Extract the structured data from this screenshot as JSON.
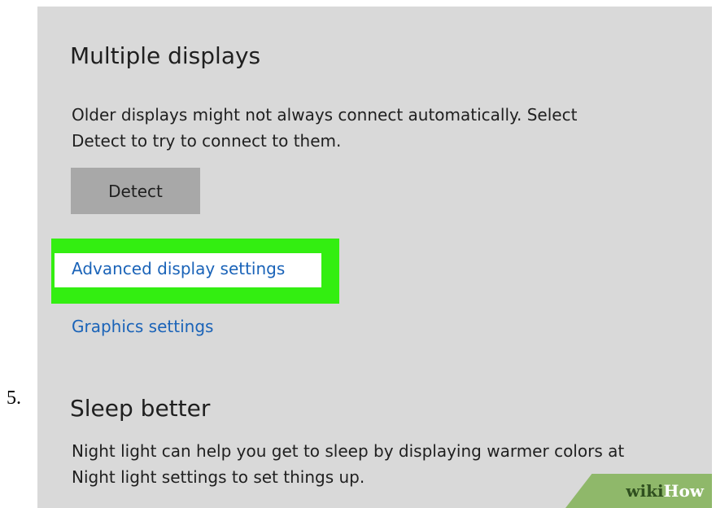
{
  "step": {
    "number": "5."
  },
  "multiple_displays": {
    "title": "Multiple displays",
    "description_line1": "Older displays might not always connect automatically. Select",
    "description_line2": "Detect to try to connect to them.",
    "detect_label": "Detect",
    "advanced_link": "Advanced display settings",
    "graphics_link": "Graphics settings"
  },
  "sleep_better": {
    "title": "Sleep better",
    "description_line1": "Night light can help you get to sleep by displaying warmer colors at",
    "description_line2": "Night light settings to set things up."
  },
  "watermark": {
    "part1": "wiki",
    "part2": "How"
  },
  "colors": {
    "panel_bg": "#d9d9d9",
    "button_bg": "#a8a8a8",
    "link": "#1a63b8",
    "highlight": "#33ee11",
    "watermark_bg": "#8fb86a"
  }
}
